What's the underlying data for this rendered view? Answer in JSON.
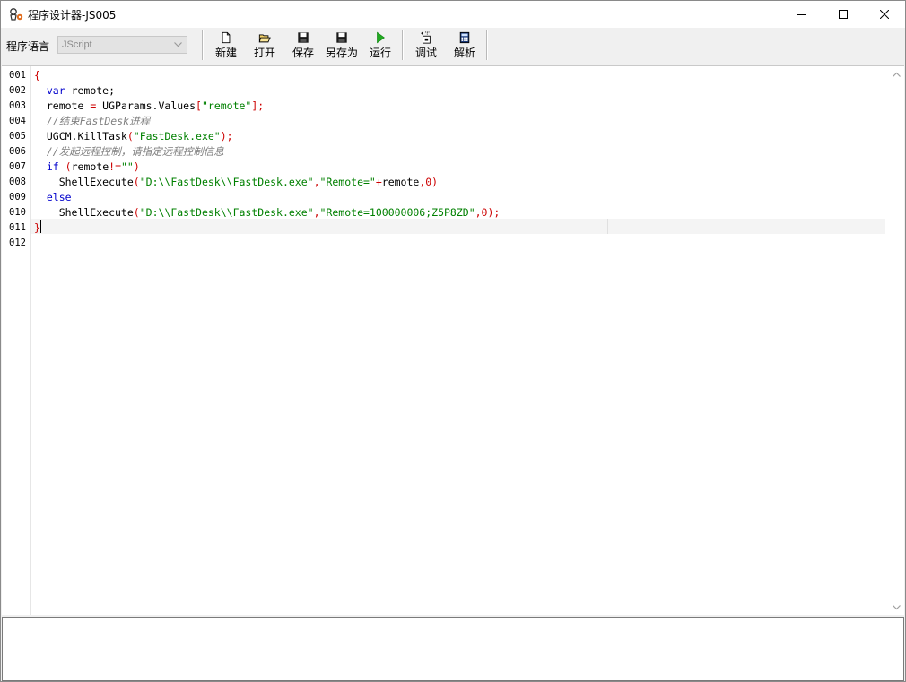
{
  "window": {
    "title": "程序设计器-JS005"
  },
  "toolbar": {
    "language_label": "程序语言",
    "language_value": "JScript",
    "buttons": {
      "new": "新建",
      "open": "打开",
      "save": "保存",
      "save_as": "另存为",
      "run": "运行",
      "debug": "调试",
      "parse": "解析"
    }
  },
  "editor": {
    "line_numbers": [
      "001",
      "002",
      "003",
      "004",
      "005",
      "006",
      "007",
      "008",
      "009",
      "010",
      "011",
      "012"
    ],
    "lines": [
      [
        {
          "t": "{",
          "c": "brace"
        }
      ],
      [
        {
          "t": "  "
        },
        {
          "t": "var",
          "c": "kw"
        },
        {
          "t": " remote;"
        }
      ],
      [
        {
          "t": "  remote "
        },
        {
          "t": "=",
          "c": "op"
        },
        {
          "t": " UGParams.Values"
        },
        {
          "t": "[",
          "c": "op"
        },
        {
          "t": "\"remote\"",
          "c": "str"
        },
        {
          "t": "];",
          "c": "op"
        }
      ],
      [
        {
          "t": "  //结束FastDesk进程",
          "c": "cmt"
        }
      ],
      [
        {
          "t": "  UGCM.KillTask"
        },
        {
          "t": "(",
          "c": "op"
        },
        {
          "t": "\"FastDesk.exe\"",
          "c": "str"
        },
        {
          "t": ");",
          "c": "op"
        }
      ],
      [
        {
          "t": "  //发起远程控制，请指定远程控制信息",
          "c": "cmt"
        }
      ],
      [
        {
          "t": "  "
        },
        {
          "t": "if",
          "c": "kw"
        },
        {
          "t": " "
        },
        {
          "t": "(",
          "c": "op"
        },
        {
          "t": "remote"
        },
        {
          "t": "!=",
          "c": "op"
        },
        {
          "t": "\"\"",
          "c": "str"
        },
        {
          "t": ")",
          "c": "op"
        }
      ],
      [
        {
          "t": "    ShellExecute"
        },
        {
          "t": "(",
          "c": "op"
        },
        {
          "t": "\"D:\\\\FastDesk\\\\FastDesk.exe\"",
          "c": "str"
        },
        {
          "t": ",",
          "c": "op"
        },
        {
          "t": "\"Remote=\"",
          "c": "str"
        },
        {
          "t": "+",
          "c": "op"
        },
        {
          "t": "remote"
        },
        {
          "t": ",0)",
          "c": "op"
        }
      ],
      [
        {
          "t": "  "
        },
        {
          "t": "else",
          "c": "kw"
        }
      ],
      [
        {
          "t": "    ShellExecute"
        },
        {
          "t": "(",
          "c": "op"
        },
        {
          "t": "\"D:\\\\FastDesk\\\\FastDesk.exe\"",
          "c": "str"
        },
        {
          "t": ",",
          "c": "op"
        },
        {
          "t": "\"Remote=100000006;Z5P8ZD\"",
          "c": "str"
        },
        {
          "t": ",0);",
          "c": "op"
        }
      ],
      [
        {
          "t": "}",
          "c": "brace"
        }
      ],
      []
    ]
  },
  "colors": {
    "keyword": "#0000cc",
    "string": "#008000",
    "operator": "#cc0000",
    "comment": "#808080",
    "run_icon": "#22aa22"
  }
}
